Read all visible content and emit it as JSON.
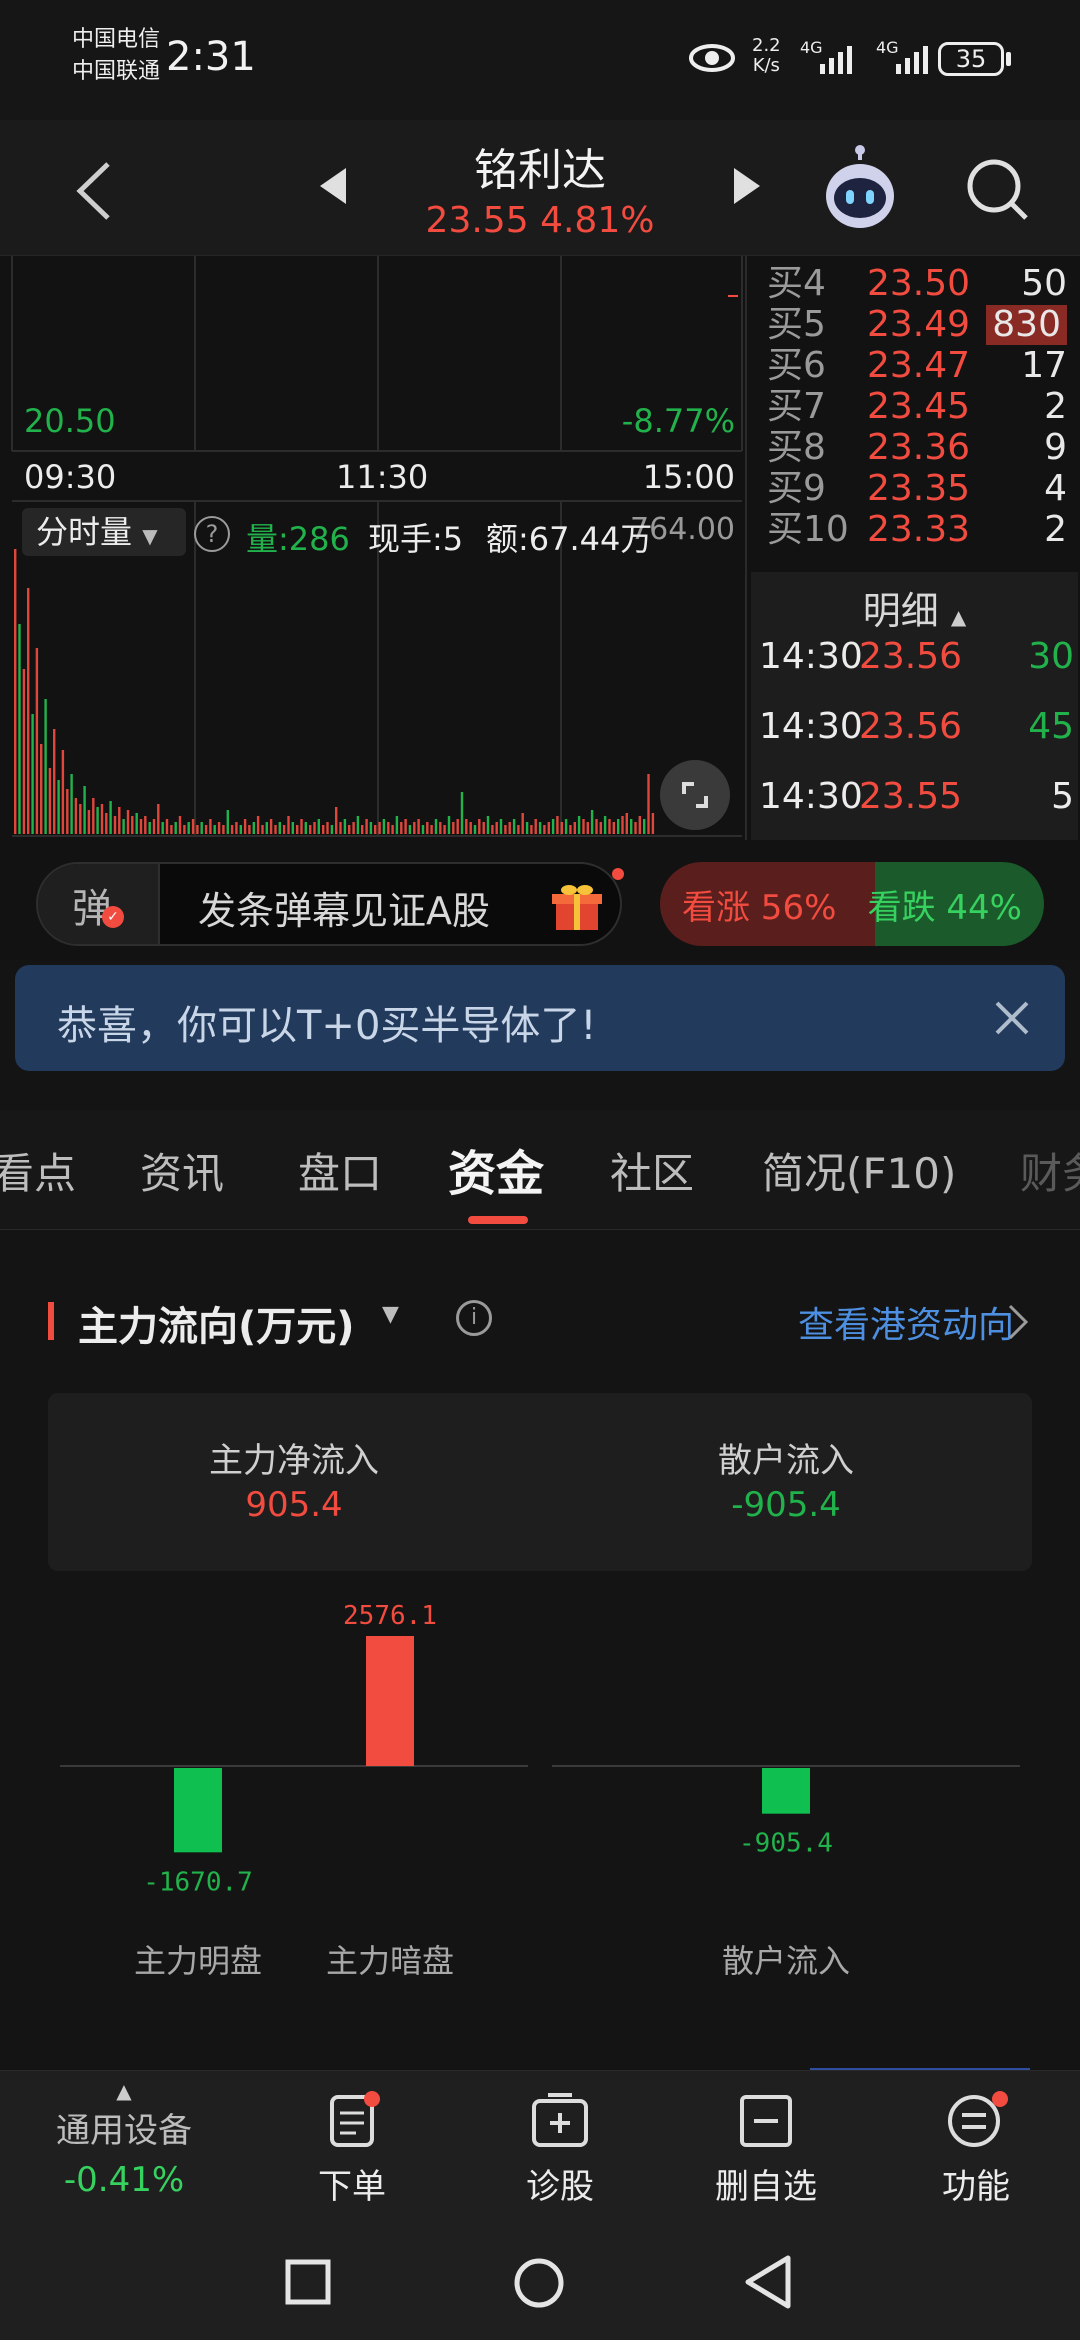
{
  "status_bar": {
    "carrier1": "中国电信",
    "carrier2": "中国联通",
    "time": "2:31",
    "net_speed_value": "2.2",
    "net_speed_unit": "K/s",
    "sig1": "4G",
    "sig2": "4G",
    "battery": "35"
  },
  "header": {
    "title": "铭利达",
    "price": "23.55",
    "change_pct": "4.81%"
  },
  "chart": {
    "low_price": "20.50",
    "low_pct": "-8.77%",
    "time_start": "09:30",
    "time_mid": "11:30",
    "time_end": "15:00",
    "volume_selector": "分时量",
    "help": "?",
    "vol_label": "量:286",
    "hand_label": "现手:5",
    "amount_label": "额:67.44万",
    "vol_max": "764.00",
    "volume_bars": [
      0.95,
      0.7,
      0.55,
      0.82,
      0.4,
      0.62,
      0.3,
      0.45,
      0.22,
      0.35,
      0.18,
      0.28,
      0.15,
      0.2,
      0.12,
      0.1,
      0.16,
      0.08,
      0.12,
      0.09,
      0.1,
      0.07,
      0.11,
      0.06,
      0.09,
      0.05,
      0.08,
      0.06,
      0.07,
      0.05,
      0.06,
      0.04,
      0.05,
      0.1,
      0.04,
      0.05,
      0.03,
      0.04,
      0.06,
      0.03,
      0.04,
      0.05,
      0.03,
      0.04,
      0.03,
      0.05,
      0.03,
      0.04,
      0.03,
      0.08,
      0.03,
      0.04,
      0.03,
      0.05,
      0.03,
      0.04,
      0.06,
      0.03,
      0.04,
      0.05,
      0.03,
      0.04,
      0.03,
      0.06,
      0.04,
      0.03,
      0.05,
      0.04,
      0.03,
      0.04,
      0.05,
      0.03,
      0.04,
      0.03,
      0.09,
      0.04,
      0.05,
      0.03,
      0.04,
      0.06,
      0.03,
      0.05,
      0.04,
      0.03,
      0.04,
      0.05,
      0.04,
      0.03,
      0.06,
      0.04,
      0.05,
      0.03,
      0.04,
      0.05,
      0.03,
      0.04,
      0.03,
      0.05,
      0.04,
      0.03,
      0.06,
      0.04,
      0.05,
      0.14,
      0.05,
      0.04,
      0.03,
      0.05,
      0.04,
      0.06,
      0.03,
      0.04,
      0.05,
      0.03,
      0.04,
      0.05,
      0.03,
      0.07,
      0.04,
      0.03,
      0.05,
      0.04,
      0.03,
      0.04,
      0.05,
      0.06,
      0.04,
      0.05,
      0.03,
      0.04,
      0.06,
      0.05,
      0.04,
      0.08,
      0.05,
      0.04,
      0.06,
      0.05,
      0.04,
      0.05,
      0.06,
      0.07,
      0.05,
      0.04,
      0.06,
      0.05,
      0.2,
      0.07
    ]
  },
  "orderbook": {
    "rows": [
      {
        "label": "买4",
        "price": "23.50",
        "qty": "50"
      },
      {
        "label": "买5",
        "price": "23.49",
        "qty": "830"
      },
      {
        "label": "买6",
        "price": "23.47",
        "qty": "17"
      },
      {
        "label": "买7",
        "price": "23.45",
        "qty": "2"
      },
      {
        "label": "买8",
        "price": "23.36",
        "qty": "9"
      },
      {
        "label": "买9",
        "price": "23.35",
        "qty": "4"
      },
      {
        "label": "买10",
        "price": "23.33",
        "qty": "2"
      }
    ],
    "detail_title": "明细",
    "details": [
      {
        "time": "14:30",
        "price": "23.56",
        "qty": "30",
        "dir": "buy"
      },
      {
        "time": "14:30",
        "price": "23.56",
        "qty": "45",
        "dir": "buy"
      },
      {
        "time": "14:30",
        "price": "23.55",
        "qty": "5",
        "dir": "neutral"
      }
    ]
  },
  "danmu": {
    "icon_char": "弹",
    "input_text": "发条弹幕见证A股",
    "rise_label": "看涨 56%",
    "fall_label": "看跌 44%",
    "rise_pct": 56
  },
  "banner": {
    "text": "恭喜，你可以T+0买半导体了!"
  },
  "tabs": {
    "items": [
      "看点",
      "资讯",
      "盘口",
      "资金",
      "社区",
      "简况(F10)",
      "财务"
    ],
    "active_index": 3
  },
  "fund": {
    "title": "主力流向(万元)",
    "hk_link": "查看港资动向",
    "net_inflow_label": "主力净流入",
    "net_inflow_value": "905.4",
    "retail_label": "散户流入",
    "retail_value": "-905.4",
    "chart_data": {
      "type": "bar",
      "categories": [
        "主力明盘",
        "主力暗盘",
        "散户流入"
      ],
      "values": [
        -1670.7,
        2576.1,
        -905.4
      ],
      "value_labels": [
        "-1670.7",
        "2576.1",
        "-905.4"
      ]
    }
  },
  "bottom_bar": {
    "sector_name": "通用设备",
    "sector_change": "-0.41%",
    "items": [
      {
        "label": "下单"
      },
      {
        "label": "诊股"
      },
      {
        "label": "删自选"
      },
      {
        "label": "功能"
      }
    ]
  },
  "colors": {
    "up": "#f24b3f",
    "down": "#22b24c",
    "banner_bg": "#223a5c",
    "link": "#4d8fe0"
  }
}
